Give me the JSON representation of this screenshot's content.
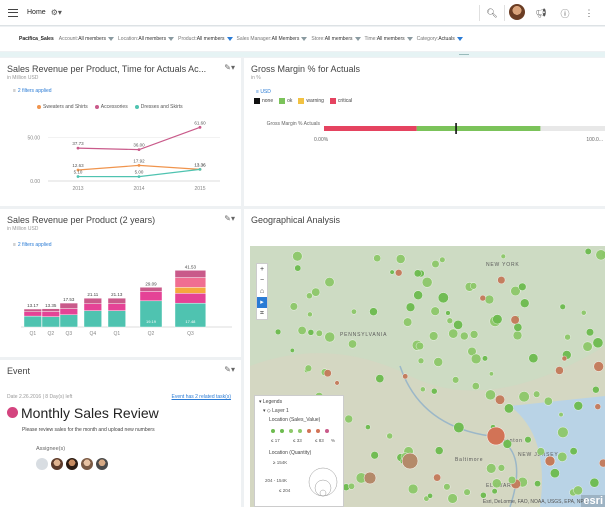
{
  "topbar": {
    "home_label": "Home",
    "icons": [
      "menu-icon",
      "wrench-icon",
      "search-icon",
      "avatar",
      "notifications-icon",
      "help-icon",
      "more-icon"
    ]
  },
  "filters": {
    "model": "Pacifica_Sales",
    "items": [
      {
        "label": "Account:",
        "value": "All members",
        "color": "#8a9aa0"
      },
      {
        "label": "Location:",
        "value": "All members",
        "color": "#8a9aa0"
      },
      {
        "label": "Product:",
        "value": "All members",
        "color": "#2a7bd5"
      },
      {
        "label": "Sales Manager:",
        "value": "All Members",
        "color": "#8a9aa0"
      },
      {
        "label": "Store:",
        "value": "All members",
        "color": "#8a9aa0"
      },
      {
        "label": "Time:",
        "value": "All members",
        "color": "#8a9aa0"
      },
      {
        "label": "Category:",
        "value": "Actuals",
        "color": "#2a7bd5"
      }
    ]
  },
  "card1": {
    "title": "Sales Revenue per Product, Time for Actuals Ac...",
    "subtitle": "in Million USD",
    "filters_applied": "2 filters applied"
  },
  "card2": {
    "title": "Gross Margin % for Actuals",
    "subtitle": "in %",
    "currency": "USD",
    "legend": [
      {
        "label": "none",
        "color": "#111111"
      },
      {
        "label": "ok",
        "color": "#7bc35a"
      },
      {
        "label": "warning",
        "color": "#f2c243"
      },
      {
        "label": "critical",
        "color": "#e54360"
      }
    ],
    "row_label": "Gross Margin % Actuals",
    "axis_min": "0.00%",
    "axis_max": "100.0..."
  },
  "card3": {
    "title": "Sales Revenue per Product (2 years)",
    "subtitle": "in Million USD",
    "filters_applied": "2 filters applied"
  },
  "card4": {
    "title": "Geographical Analysis",
    "map_labels": [
      "NEW YORK",
      "PENNSYLVANIA",
      "NEW JERSEY",
      "Baltimore",
      "Trenton",
      "ELAWARE"
    ],
    "attribution": "Esri, DeLorme, FAO, NOAA, USGS, EPA, NPS",
    "esri": "esri",
    "legend": {
      "header": "Legends",
      "layer": "Layer 1",
      "color_label": "Location (Sales_Value)",
      "color_ticks": [
        "≤ 17",
        "≤ 33",
        "≤ 83",
        "%"
      ],
      "size_label": "Location (Quantity)",
      "size_ticks": [
        "≥ 154K",
        "204 - 154K",
        "≤ 204"
      ]
    }
  },
  "card5": {
    "title": "Event",
    "meta": "Date 2.26.2016 | 8 Day(s) left",
    "link": "Event has 2 related task(s)",
    "event_title": "Monthly Sales Review",
    "event_desc": "Please review sales for the month and upload new numbers",
    "assignees_label": "Assignee(s)",
    "accent": "#d4447f"
  },
  "chart_data": [
    {
      "type": "line",
      "x": [
        "2013",
        "2014",
        "2015"
      ],
      "series": [
        {
          "name": "Sweaters and Shirts",
          "color": "#f0944d",
          "values": [
            12.63,
            17.92,
            13.36
          ]
        },
        {
          "name": "Accessories",
          "color": "#c95a8a",
          "values": [
            37.73,
            36.0,
            61.6
          ]
        },
        {
          "name": "Dresses and Skirts",
          "color": "#4fc3b0",
          "values": [
            5.1,
            5.0,
            13.36
          ]
        }
      ],
      "y_ticks": [
        "0.00",
        "50.00"
      ],
      "ylim": [
        0,
        70
      ],
      "legend": "top",
      "grid": false
    },
    {
      "type": "bar",
      "stacked": true,
      "categories": [
        "Q1",
        "Q2",
        "Q3",
        "Q4",
        "Q1",
        "Q2",
        "Q3"
      ],
      "colors": [
        "#4fc3b0",
        "#e54396",
        "#f5a83f",
        "#f06e92",
        "#c95a8a"
      ],
      "totals": [
        13.17,
        13.35,
        17.53,
        21.11,
        21.13,
        29.09,
        41.53
      ],
      "segments": [
        [
          8.0,
          3.17,
          0,
          0,
          2.0
        ],
        [
          7.6,
          3.75,
          0,
          0,
          2.0
        ],
        [
          9.0,
          4.53,
          0,
          0,
          4.0
        ],
        [
          12.0,
          5.11,
          0,
          0,
          4.0
        ],
        [
          12.0,
          5.13,
          0,
          0,
          4.0
        ],
        [
          19.19,
          6.9,
          0,
          0,
          3.0
        ],
        [
          17.48,
          7.21,
          4.37,
          7.21,
          5.26
        ]
      ],
      "inner_labels": {
        "3": "",
        "6": ""
      },
      "labels": [
        "",
        "",
        "",
        "",
        "",
        "19.19",
        "17.48"
      ],
      "ylim": [
        0,
        45
      ],
      "grid": false
    },
    {
      "type": "bar",
      "orientation": "horizontal",
      "categories": [
        "Gross Margin % Actuals"
      ],
      "value": 47,
      "ranges": [
        {
          "to": 33,
          "color": "#e54360"
        },
        {
          "to": 77,
          "color": "#7bc35a"
        }
      ],
      "xlim": [
        0,
        100
      ]
    }
  ]
}
